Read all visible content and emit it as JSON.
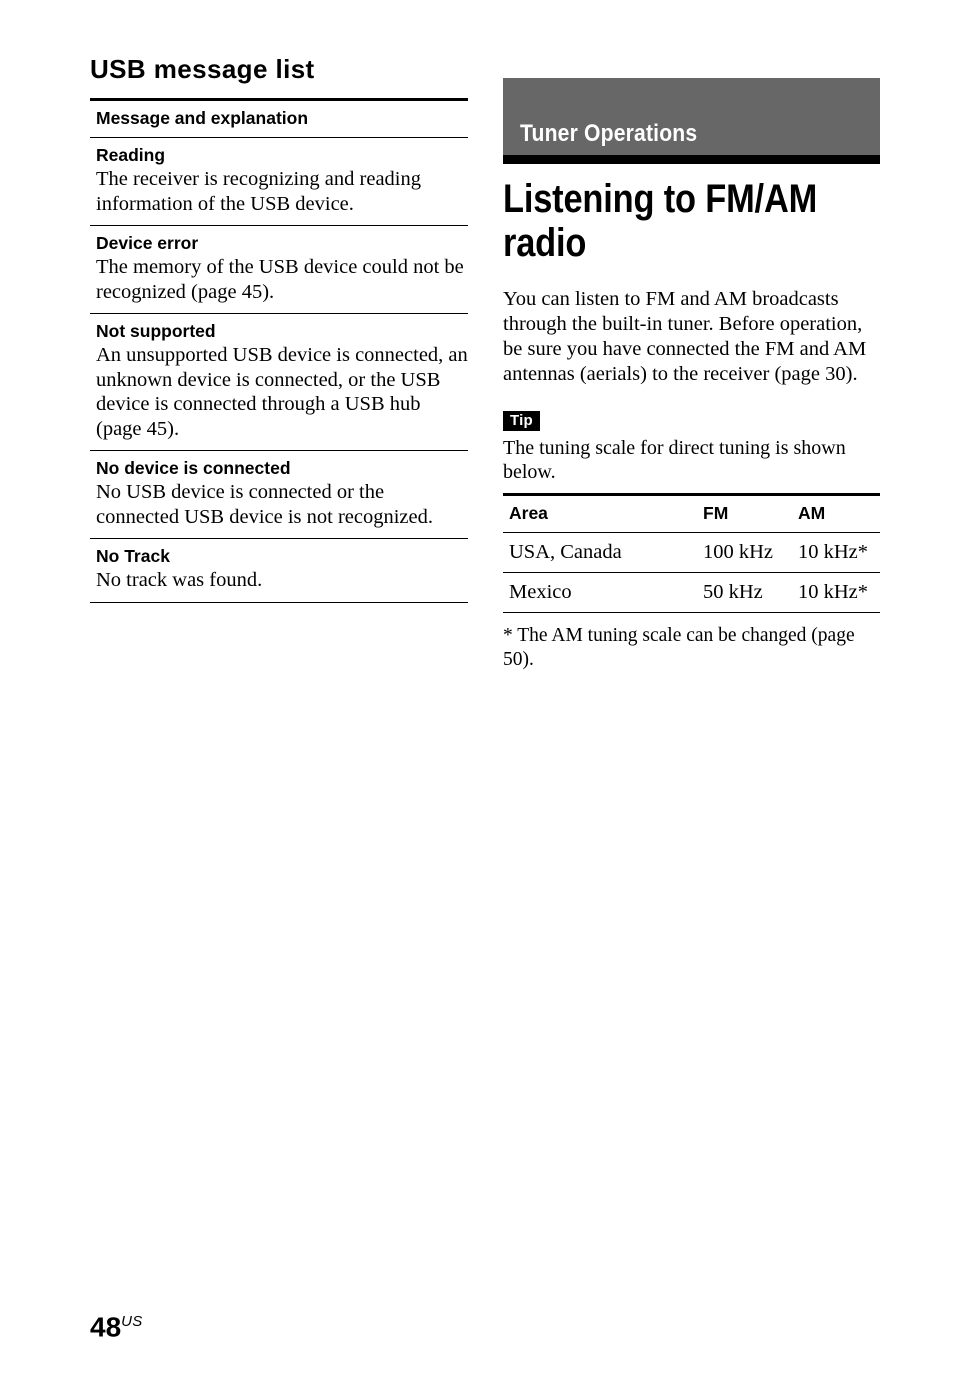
{
  "left_column": {
    "heading": "USB message list",
    "table": {
      "header": "Message and explanation",
      "rows": [
        {
          "title": "Reading",
          "description": "The receiver is recognizing and reading information of the USB device."
        },
        {
          "title": "Device error",
          "description": "The memory of the USB device could not be recognized (page 45)."
        },
        {
          "title": "Not supported",
          "description": "An unsupported USB device is connected, an unknown device is connected, or the USB device is connected through a USB hub (page 45)."
        },
        {
          "title": "No device is connected",
          "description": "No USB device is connected or the connected USB device is not recognized."
        },
        {
          "title": "No Track",
          "description": "No track was found."
        }
      ]
    }
  },
  "right_column": {
    "banner_label": "Tuner Operations",
    "banner_color": "#676767",
    "title": "Listening to FM/AM radio",
    "intro": "You can listen to FM and AM broadcasts through the built-in tuner. Before operation, be sure you have connected the FM and AM antennas (aerials) to the receiver (page 30).",
    "tip_badge": "Tip",
    "tip_text": "The tuning scale for direct tuning is shown below.",
    "scale_table": {
      "columns": [
        "Area",
        "FM",
        "AM"
      ],
      "rows": [
        [
          "USA, Canada",
          "100 kHz",
          "10 kHz*"
        ],
        [
          "Mexico",
          "50 kHz",
          "10 kHz*"
        ]
      ]
    },
    "footnote": "*  The AM tuning scale can be changed (page 50)."
  },
  "footer": {
    "page_number": "48",
    "page_suffix": "US"
  }
}
